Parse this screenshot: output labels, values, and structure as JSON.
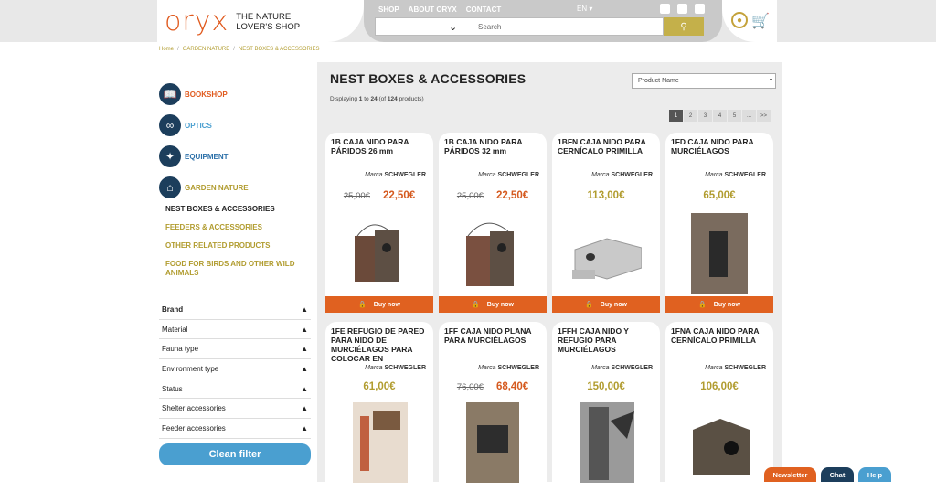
{
  "header": {
    "logo_text": "oryx",
    "tagline_1": "THE NATURE",
    "tagline_2": "LOVER'S SHOP",
    "nav": [
      "SHOP",
      "ABOUT ORYX",
      "CONTACT"
    ],
    "lang": "EN",
    "search_placeholder": "Search"
  },
  "breadcrumb": [
    "Home",
    "GARDEN NATURE",
    "NEST BOXES & ACCESSORIES"
  ],
  "sidebar": {
    "categories": [
      {
        "label": "BOOKSHOP",
        "color": "#e05a1e",
        "icon": "book-icon"
      },
      {
        "label": "OPTICS",
        "color": "#4a9fd0",
        "icon": "binoculars-icon"
      },
      {
        "label": "EQUIPMENT",
        "color": "#2b6fa8",
        "icon": "butterfly-icon"
      },
      {
        "label": "GARDEN NATURE",
        "color": "#b19c2f",
        "icon": "birdhouse-icon"
      }
    ],
    "subcats": [
      "NEST BOXES & ACCESSORIES",
      "FEEDERS & ACCESSORIES",
      "OTHER RELATED PRODUCTS",
      "FOOD FOR BIRDS AND OTHER WILD ANIMALS"
    ],
    "filters": [
      "Brand",
      "Material",
      "Fauna type",
      "Environment type",
      "Status",
      "Shelter accessories",
      "Feeder accessories"
    ],
    "clean_label": "Clean filter"
  },
  "main": {
    "title": "NEST BOXES & ACCESSORIES",
    "sort_value": "Product Name",
    "display_prefix": "Displaying ",
    "display_from": "1",
    "display_to_word": " to ",
    "display_to": "24",
    "display_of": " (of ",
    "display_total": "124",
    "display_suffix": " products)",
    "pager": [
      "1",
      "2",
      "3",
      "4",
      "5",
      "...",
      ">>"
    ],
    "buy_label": "Buy now",
    "brand_prefix": "Marca",
    "products": [
      {
        "name": "1B CAJA NIDO PARA PÁRIDOS 26 mm",
        "brand": "SCHWEGLER",
        "old": "25,00€",
        "price": "22,50€"
      },
      {
        "name": "1B CAJA NIDO PARA PÁRIDOS 32 mm",
        "brand": "SCHWEGLER",
        "old": "25,00€",
        "price": "22,50€"
      },
      {
        "name": "1BFN CAJA NIDO PARA CERNÍCALO PRIMILLA",
        "brand": "SCHWEGLER",
        "old": "",
        "price": "113,00€"
      },
      {
        "name": "1FD CAJA NIDO PARA MURCIÉLAGOS",
        "brand": "SCHWEGLER",
        "old": "",
        "price": "65,00€"
      },
      {
        "name": "1FE REFUGIO DE PARED PARA NIDO DE MURCIÉLAGOS PARA COLOCAR EN",
        "brand": "SCHWEGLER",
        "old": "",
        "price": "61,00€"
      },
      {
        "name": "1FF CAJA NIDO PLANA PARA MURCIÉLAGOS",
        "brand": "SCHWEGLER",
        "old": "76,00€",
        "price": "68,40€"
      },
      {
        "name": "1FFH CAJA NIDO Y REFUGIO PARA MURCIÉLAGOS",
        "brand": "SCHWEGLER",
        "old": "",
        "price": "150,00€"
      },
      {
        "name": "1FNA CAJA NIDO PARA CERNÍCALO PRIMILLA",
        "brand": "SCHWEGLER",
        "old": "",
        "price": "106,00€"
      }
    ]
  },
  "floating": [
    "Newsletter",
    "Chat",
    "Help"
  ]
}
